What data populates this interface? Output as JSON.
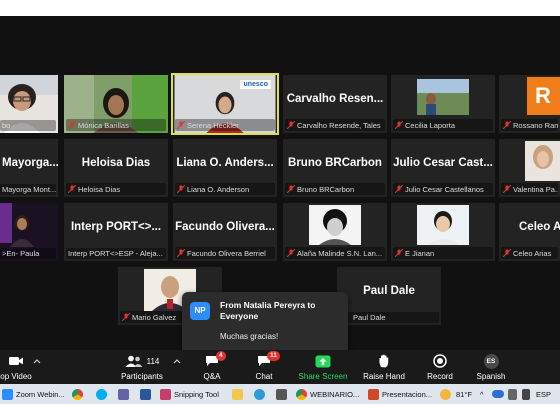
{
  "tiles": [
    {
      "label": "bo",
      "big": ""
    },
    {
      "label": "Mónica Barillas",
      "big": ""
    },
    {
      "label": "Serena Heckler",
      "big": "",
      "brand": "unesco"
    },
    {
      "label": "Carvalho Resende, Tales",
      "big": "Carvalho Resen..."
    },
    {
      "label": "Cecilia Laporta",
      "big": ""
    },
    {
      "label": "Rossano Ramos",
      "big": "R"
    },
    {
      "label": "Mayorga Mont...",
      "big": "Mayorga..."
    },
    {
      "label": "Heloisa Dias",
      "big": "Heloisa Dias"
    },
    {
      "label": "Liana O. Anderson",
      "big": "Liana O. Anders..."
    },
    {
      "label": "Bruno BRCarbon",
      "big": "Bruno BRCarbon"
    },
    {
      "label": "Julio Cesar Castellanos",
      "big": "Julio Cesar Cast..."
    },
    {
      "label": "Valentina Pa...",
      "big": ""
    },
    {
      "label": ">En- Paula",
      "big": ""
    },
    {
      "label": "Interp PORT<>ESP - Aleja...",
      "big": "Interp PORT<>..."
    },
    {
      "label": "Facundo Olivera Berriel",
      "big": "Facundo Olivera..."
    },
    {
      "label": "Alaña Malinde S.N. Lan...",
      "big": ""
    },
    {
      "label": "E Jianan",
      "big": ""
    },
    {
      "label": "Celeo Arias",
      "big": "Celeo A..."
    },
    {
      "label": "Mario Galvez",
      "big": ""
    },
    {
      "label": "Paul Dale",
      "big": "Paul Dale"
    }
  ],
  "toast": {
    "initials": "NP",
    "from": "From Natalia Pereyra to Everyone",
    "message": "Muchas gracias!"
  },
  "toolbar": {
    "stop_video": "op Video",
    "participants": "Participants",
    "participants_count": "114",
    "qa": "Q&A",
    "qa_count": "4",
    "chat": "Chat",
    "chat_count": "11",
    "share": "Share Screen",
    "raise": "Raise Hand",
    "record": "Record",
    "language": "Spanish",
    "language_code": "ES"
  },
  "taskbar": {
    "zoom": "Zoom Webin...",
    "snipping": "Snipping Tool",
    "webinar": "WEBINARIO...",
    "presentation": "Presentacion...",
    "temp": "81°F",
    "lang": "ESP"
  },
  "colors": {
    "active_border": "#d9e24a",
    "share_green": "#23d959",
    "badge_red": "#e5322d",
    "zoom_blue": "#2d8cff"
  }
}
